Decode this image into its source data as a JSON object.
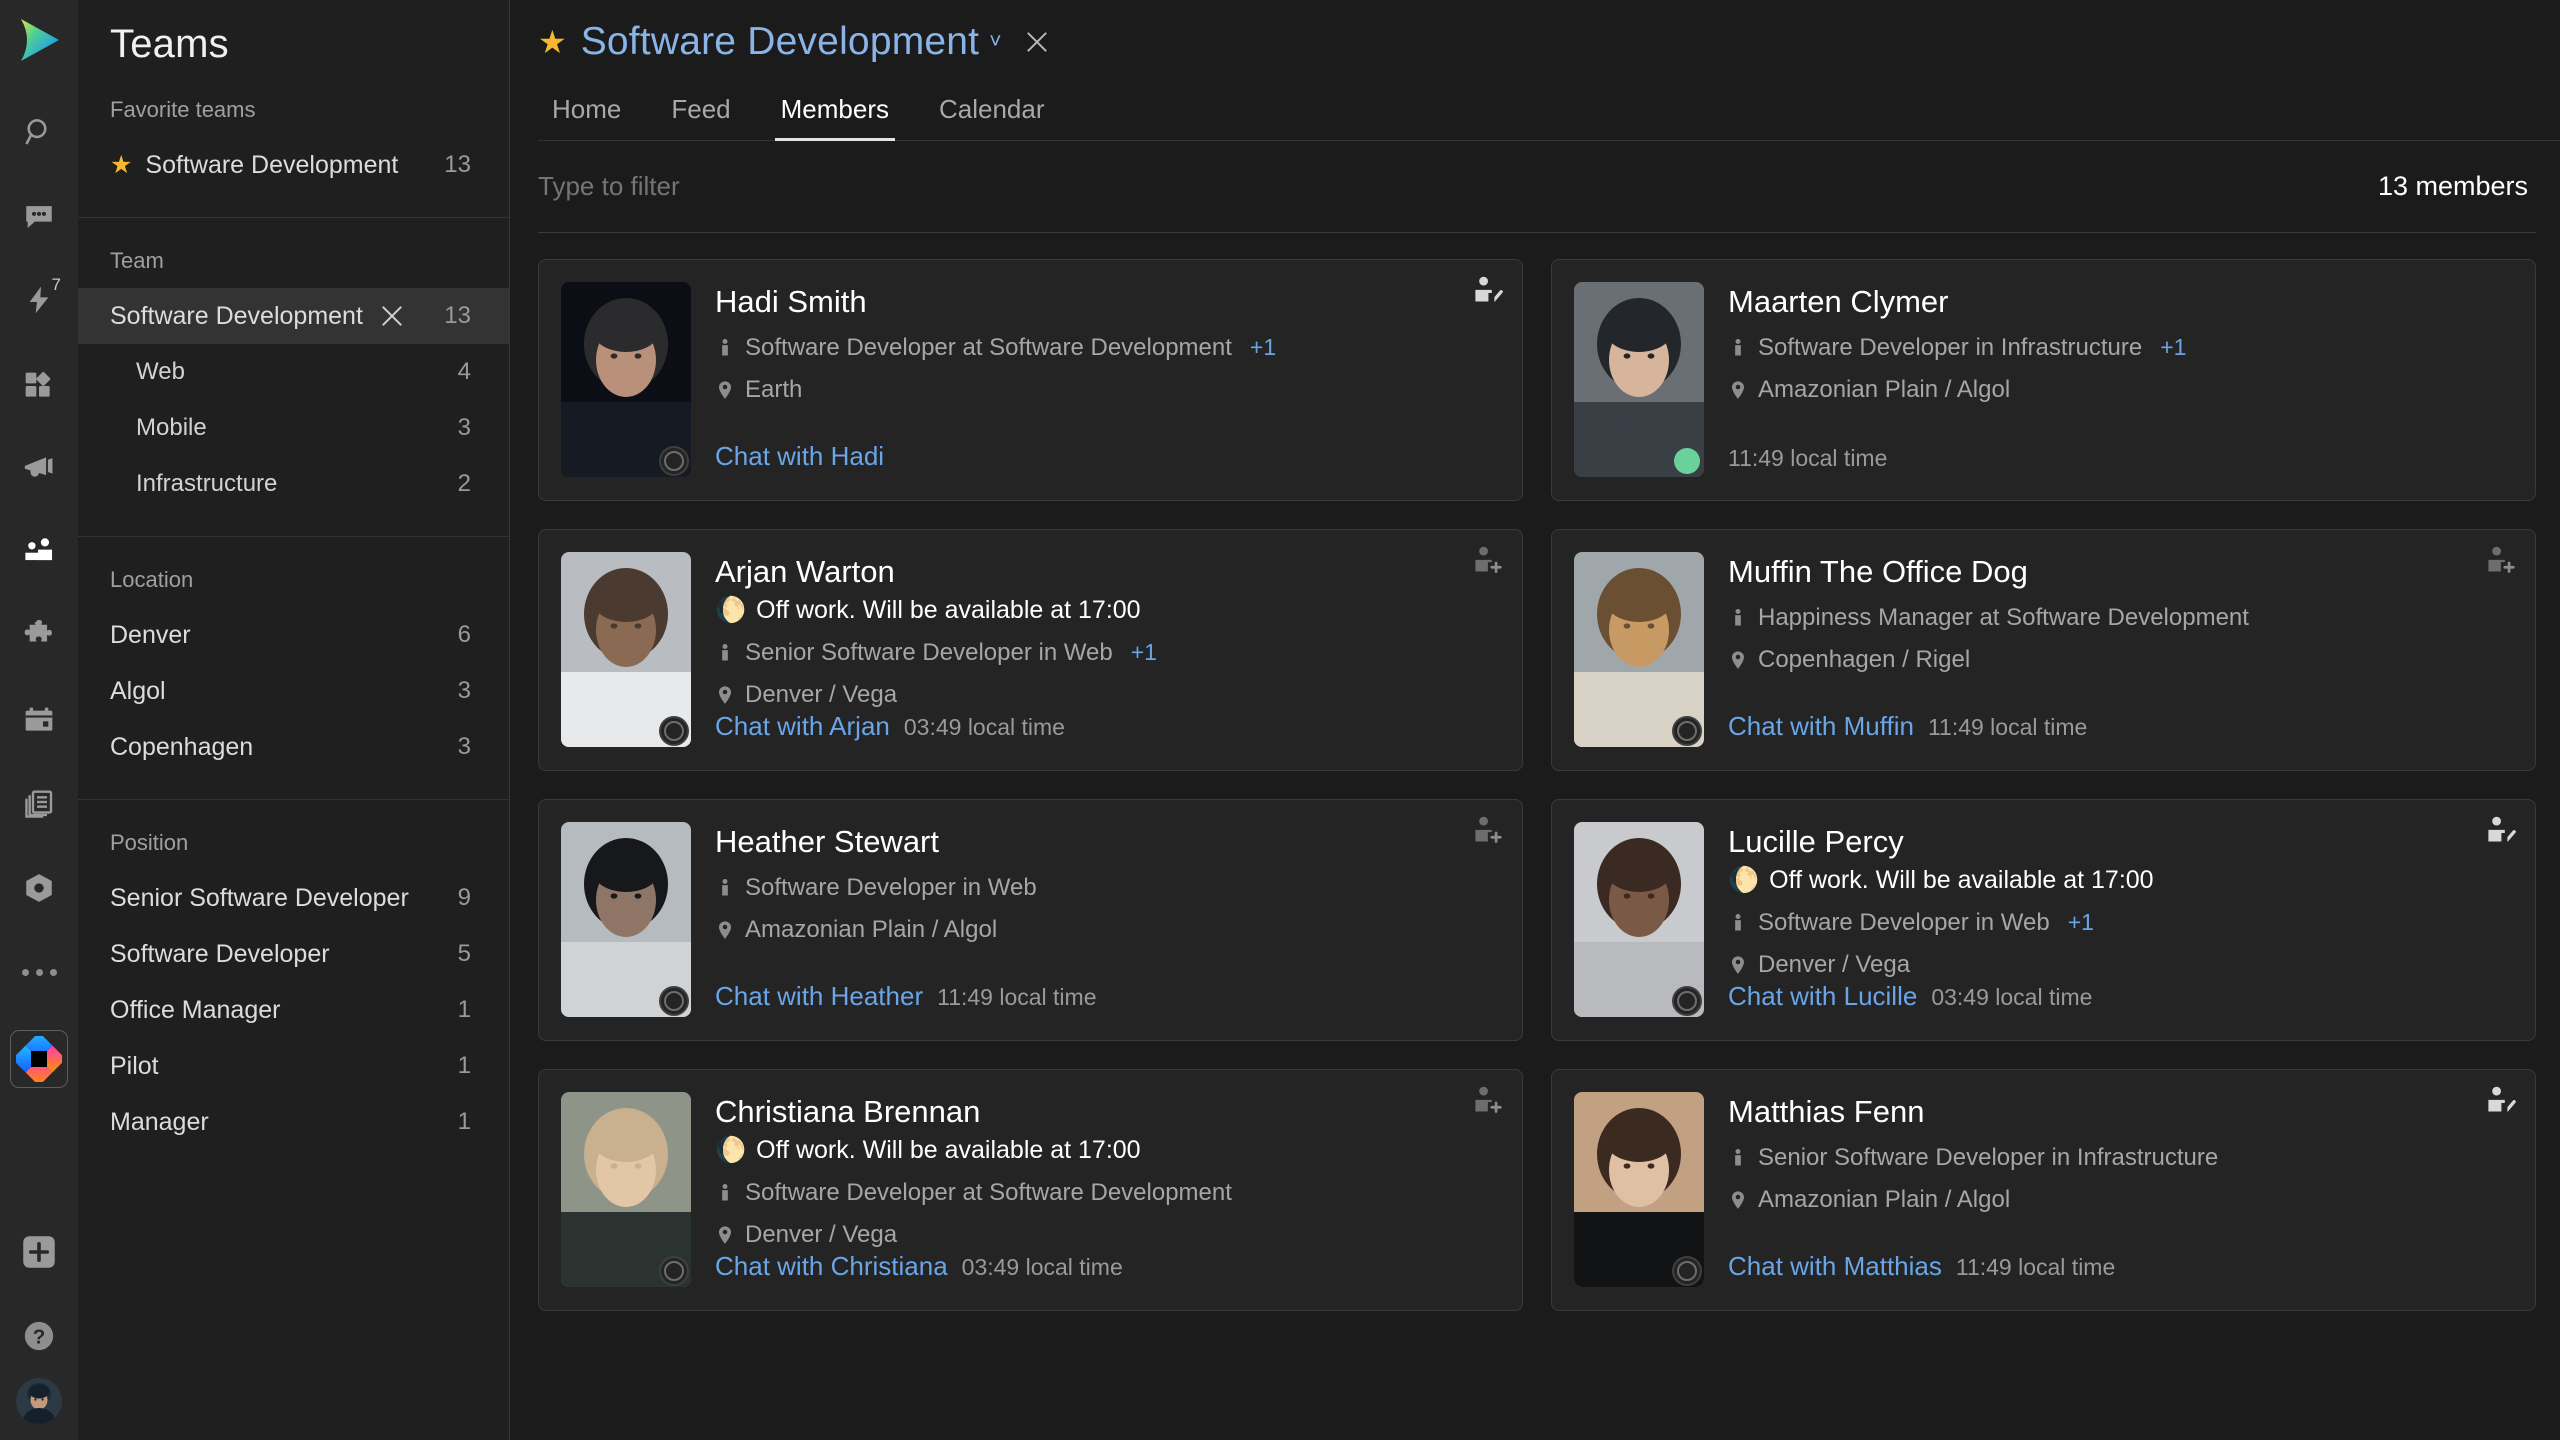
{
  "rail": {
    "logo_icon": "teams-logo-icon",
    "items": [
      {
        "icon": "search-icon",
        "name": "search",
        "badge": null,
        "active": false
      },
      {
        "icon": "chat-icon",
        "name": "chat",
        "badge": null,
        "active": false
      },
      {
        "icon": "activity-lightning-icon",
        "name": "activity",
        "badge": "7",
        "active": false
      },
      {
        "icon": "apps-grid-icon",
        "name": "apps",
        "badge": null,
        "active": false
      },
      {
        "icon": "megaphone-icon",
        "name": "announcements",
        "badge": null,
        "active": false
      },
      {
        "icon": "people-icon",
        "name": "teams-people",
        "badge": null,
        "active": true
      },
      {
        "icon": "puzzle-icon",
        "name": "integrations",
        "badge": null,
        "active": false
      },
      {
        "icon": "calendar-icon",
        "name": "calendar",
        "badge": null,
        "active": false
      },
      {
        "icon": "news-list-icon",
        "name": "news",
        "badge": null,
        "active": false
      },
      {
        "icon": "hexnut-icon",
        "name": "settings-hex",
        "badge": null,
        "active": false
      },
      {
        "icon": "more-dots-icon",
        "name": "more",
        "badge": null,
        "active": false
      }
    ],
    "bottom": [
      {
        "icon": "app-tile-icon",
        "name": "active-app-tile"
      },
      {
        "icon": "plus-icon",
        "name": "add"
      },
      {
        "icon": "help-icon",
        "name": "help"
      },
      {
        "icon": "user-avatar-icon",
        "name": "account-avatar"
      }
    ]
  },
  "sidebar": {
    "title": "Teams",
    "sections": [
      {
        "header": "Favorite teams",
        "items": [
          {
            "label": "Software Development",
            "count": "13",
            "star": true,
            "selected": false,
            "sub": false,
            "closable": false
          }
        ]
      },
      {
        "header": "Team",
        "items": [
          {
            "label": "Software Development",
            "count": "13",
            "star": false,
            "selected": true,
            "sub": false,
            "closable": true
          },
          {
            "label": "Web",
            "count": "4",
            "star": false,
            "selected": false,
            "sub": true,
            "closable": false
          },
          {
            "label": "Mobile",
            "count": "3",
            "star": false,
            "selected": false,
            "sub": true,
            "closable": false
          },
          {
            "label": "Infrastructure",
            "count": "2",
            "star": false,
            "selected": false,
            "sub": true,
            "closable": false
          }
        ]
      },
      {
        "header": "Location",
        "items": [
          {
            "label": "Denver",
            "count": "6",
            "star": false,
            "selected": false,
            "sub": false,
            "closable": false
          },
          {
            "label": "Algol",
            "count": "3",
            "star": false,
            "selected": false,
            "sub": false,
            "closable": false
          },
          {
            "label": "Copenhagen",
            "count": "3",
            "star": false,
            "selected": false,
            "sub": false,
            "closable": false
          }
        ]
      },
      {
        "header": "Position",
        "items": [
          {
            "label": "Senior Software Developer",
            "count": "9",
            "star": false,
            "selected": false,
            "sub": false,
            "closable": false
          },
          {
            "label": "Software Developer",
            "count": "5",
            "star": false,
            "selected": false,
            "sub": false,
            "closable": false
          },
          {
            "label": "Office Manager",
            "count": "1",
            "star": false,
            "selected": false,
            "sub": false,
            "closable": false
          },
          {
            "label": "Pilot",
            "count": "1",
            "star": false,
            "selected": false,
            "sub": false,
            "closable": false
          },
          {
            "label": "Manager",
            "count": "1",
            "star": false,
            "selected": false,
            "sub": false,
            "closable": false
          }
        ]
      }
    ]
  },
  "header": {
    "star_icon": "star-icon",
    "title": "Software Development",
    "chevron": "˅",
    "close_icon": "close-icon",
    "tabs": [
      {
        "label": "Home",
        "active": false
      },
      {
        "label": "Feed",
        "active": false
      },
      {
        "label": "Members",
        "active": true
      },
      {
        "label": "Calendar",
        "active": false
      }
    ]
  },
  "filter": {
    "placeholder": "Type to filter",
    "value": "",
    "count_label": "13 members"
  },
  "colors": {
    "accent_link": "#6aa5e8",
    "title_blue": "#8ab4e8",
    "star_gold": "#f7b731",
    "status_orange": "#f08a24",
    "presence_online": "#6ad19a",
    "card_bg": "#242424",
    "sidebar_bg": "#1f1f1f",
    "rail_bg": "#282828",
    "main_bg": "#1b1b1b"
  },
  "members": [
    {
      "name": "Hadi Smith",
      "status": null,
      "position": "Software Developer at Software Development",
      "position_extra": "+1",
      "location": "Earth",
      "chat_label": "Chat with Hadi",
      "local_time": null,
      "badge_icon": "person-check-icon",
      "badge_state": "member",
      "presence": "offline",
      "photo": "hadi-smith-photo"
    },
    {
      "name": "Maarten Clymer",
      "status": null,
      "position": "Software Developer in Infrastructure",
      "position_extra": "+1",
      "location": "Amazonian Plain / Algol",
      "chat_label": null,
      "local_time": "11:49 local time",
      "badge_icon": null,
      "badge_state": "none",
      "presence": "online",
      "photo": "maarten-clymer-photo"
    },
    {
      "name": "Arjan Warton",
      "status": "Off work. Will be available at 17:00",
      "position": "Senior Software Developer in Web",
      "position_extra": "+1",
      "location": "Denver / Vega",
      "chat_label": "Chat with Arjan",
      "local_time": "03:49 local time",
      "badge_icon": "person-add-icon",
      "badge_state": "add",
      "presence": "offline",
      "photo": "arjan-warton-photo"
    },
    {
      "name": "Muffin The Office Dog",
      "status": null,
      "position": "Happiness Manager at Software Development",
      "position_extra": null,
      "location": "Copenhagen / Rigel",
      "chat_label": "Chat with Muffin",
      "local_time": "11:49 local time",
      "badge_icon": "person-add-icon",
      "badge_state": "add",
      "presence": "offline",
      "photo": "muffin-dog-photo"
    },
    {
      "name": "Heather Stewart",
      "status": null,
      "position": "Software Developer in Web",
      "position_extra": null,
      "location": "Amazonian Plain / Algol",
      "chat_label": "Chat with Heather",
      "local_time": "11:49 local time",
      "badge_icon": "person-add-icon",
      "badge_state": "add",
      "presence": "offline",
      "photo": "heather-stewart-photo"
    },
    {
      "name": "Lucille Percy",
      "status": "Off work. Will be available at 17:00",
      "position": "Software Developer in Web",
      "position_extra": "+1",
      "location": "Denver / Vega",
      "chat_label": "Chat with Lucille",
      "local_time": "03:49 local time",
      "badge_icon": "person-check-icon",
      "badge_state": "member",
      "presence": "offline",
      "photo": "lucille-percy-photo"
    },
    {
      "name": "Christiana Brennan",
      "status": "Off work. Will be available at 17:00",
      "position": "Software Developer at Software Development",
      "position_extra": null,
      "location": "Denver / Vega",
      "chat_label": "Chat with Christiana",
      "local_time": "03:49 local time",
      "badge_icon": "person-add-icon",
      "badge_state": "add",
      "presence": "offline",
      "photo": "christiana-brennan-photo"
    },
    {
      "name": "Matthias Fenn",
      "status": null,
      "position": "Senior Software Developer in Infrastructure",
      "position_extra": null,
      "location": "Amazonian Plain / Algol",
      "chat_label": "Chat with Matthias",
      "local_time": "11:49 local time",
      "badge_icon": "person-check-icon",
      "badge_state": "member",
      "presence": "offline",
      "photo": "matthias-fenn-photo"
    }
  ]
}
